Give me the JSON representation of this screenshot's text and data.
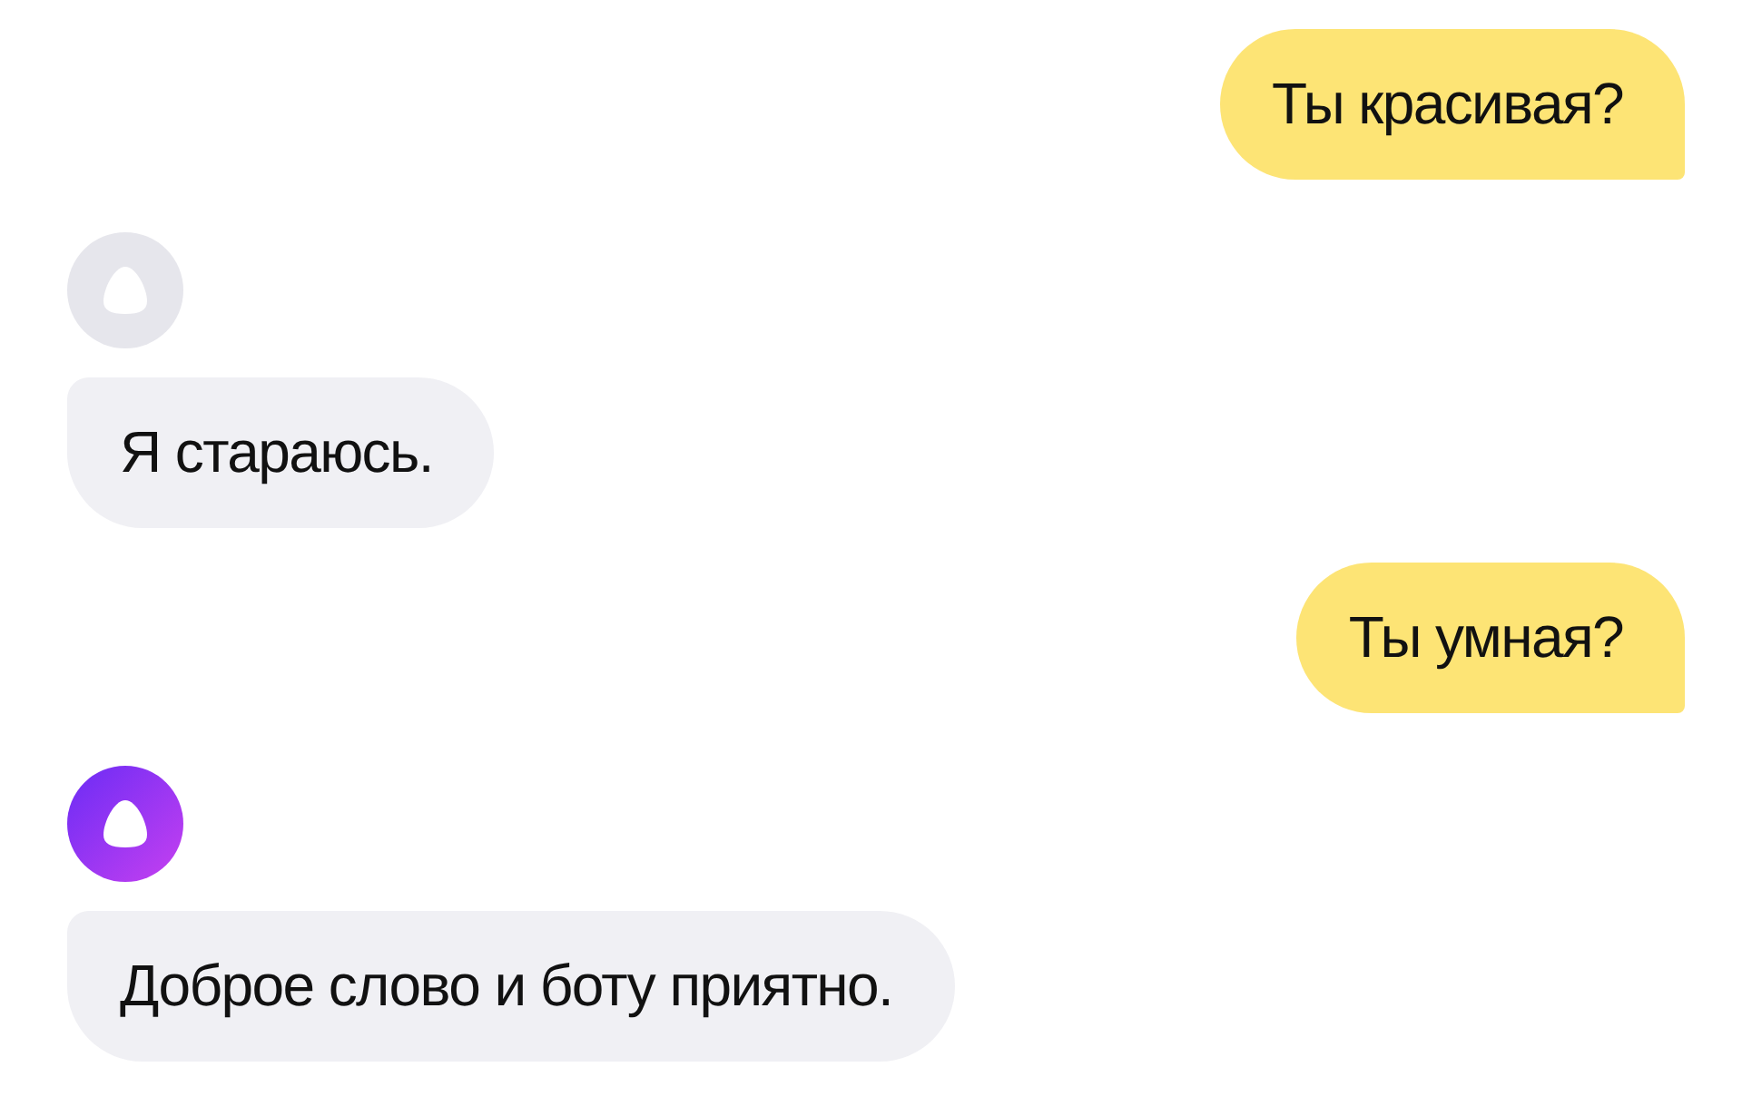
{
  "messages": [
    {
      "kind": "user",
      "text": "Ты красивая?"
    },
    {
      "kind": "bot",
      "avatar_active": false,
      "text": "Я стараюсь."
    },
    {
      "kind": "user",
      "text": "Ты умная?"
    },
    {
      "kind": "bot",
      "avatar_active": true,
      "text": "Доброе слово и боту приятно."
    }
  ]
}
